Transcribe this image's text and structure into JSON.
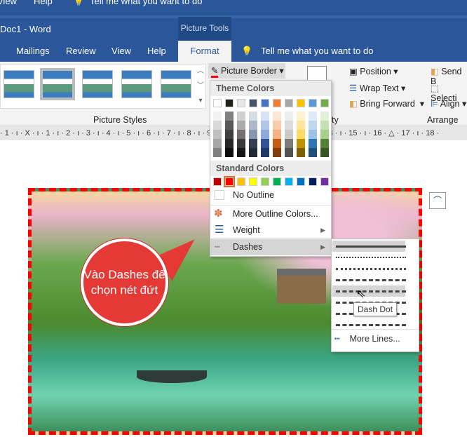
{
  "top_bar": {
    "items": [
      "View",
      "Help"
    ],
    "tell_me": "Tell me what you want to do"
  },
  "title_bar": {
    "title": "Doc1  -  Word",
    "context": "Picture Tools"
  },
  "tabs": [
    "Mailings",
    "Review",
    "View",
    "Help",
    "Format"
  ],
  "tell_me": "Tell me what you want to do",
  "ribbon": {
    "picture_styles_label": "Picture Styles",
    "picture_border": "Picture Border",
    "group_partial": "ty",
    "position": "Position",
    "wrap_text": "Wrap Text",
    "bring_forward": "Bring Forward",
    "send_backward": "Send B",
    "selection": "Selecti",
    "align": "Align",
    "arrange_label": "Arrange"
  },
  "ruler": "· 1 · ı · X · ı · 1 · ı · 2 · ı · 3 · ı · 4 · ı · 5 · ı · 6 · ı · 7 · ı · 8 · ı · 9 · ı · 10 · ı · 11 · ı · 12 · ı · 13 · ı · 14 · ı · 15 · ı · 16 · △ · 17 · ı · 18 ·",
  "menu": {
    "theme_header": "Theme Colors",
    "theme_colors": [
      "#ffffff",
      "#1e2217",
      "#e7e6e6",
      "#44546a",
      "#4472c4",
      "#ed7d31",
      "#a5a5a5",
      "#ffc000",
      "#5b9bd5",
      "#70ad47"
    ],
    "theme_shades": [
      [
        "#f2f2f2",
        "#d9d9d9",
        "#bfbfbf",
        "#a6a6a6",
        "#808080"
      ],
      [
        "#808080",
        "#595959",
        "#3f3f3f",
        "#262626",
        "#0d0d0d"
      ],
      [
        "#d0cece",
        "#aeabab",
        "#757070",
        "#3a3838",
        "#171616"
      ],
      [
        "#d6dce4",
        "#adb9ca",
        "#8496b0",
        "#333f4f",
        "#222a35"
      ],
      [
        "#d9e2f3",
        "#b4c6e7",
        "#8eaadb",
        "#2f5496",
        "#1f3864"
      ],
      [
        "#fbe5d5",
        "#f7cbac",
        "#f4b183",
        "#c55a11",
        "#833c0b"
      ],
      [
        "#ededed",
        "#dbdbdb",
        "#c9c9c9",
        "#7b7b7b",
        "#525252"
      ],
      [
        "#fff2cc",
        "#fee599",
        "#ffd965",
        "#bf9000",
        "#7f6000"
      ],
      [
        "#deebf6",
        "#bdd7ee",
        "#9cc3e5",
        "#2e75b5",
        "#1f4e79"
      ],
      [
        "#e2efd9",
        "#c5e0b3",
        "#a8d08d",
        "#538135",
        "#375623"
      ]
    ],
    "standard_header": "Standard Colors",
    "standard_colors": [
      "#c00000",
      "#ff0000",
      "#ffc000",
      "#ffff00",
      "#92d050",
      "#00b050",
      "#00b0f0",
      "#0070c0",
      "#002060",
      "#7030a0"
    ],
    "no_outline": "No Outline",
    "more_colors": "More Outline Colors...",
    "weight": "Weight",
    "dashes": "Dashes"
  },
  "dashes_submenu": {
    "more_lines": "More Lines...",
    "tooltip": "Dash Dot",
    "styles": [
      "solid",
      "round-dot",
      "square-dot",
      "dash",
      "dash-dot",
      "long-dash",
      "long-dash-dot",
      "long-dash-dot-dot"
    ],
    "highlighted": "dash-dot"
  },
  "callout": "Vào Dashes để chọn nét đứt",
  "picture": {
    "border_color": "#ff0000",
    "border_style": "dash-dot"
  }
}
